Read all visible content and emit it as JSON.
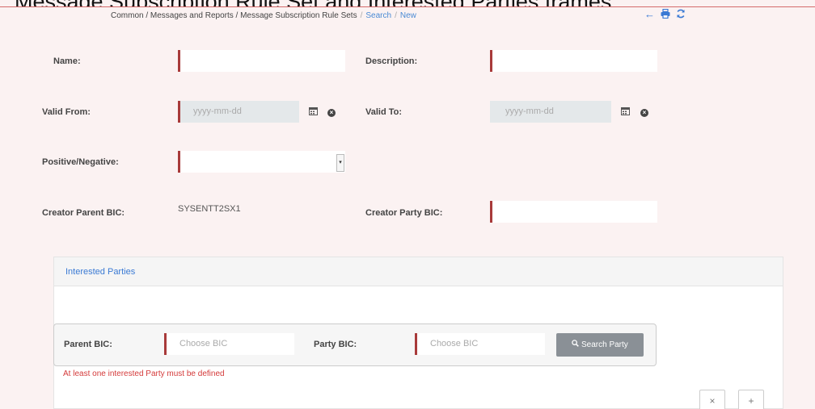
{
  "doc_title": "Message Subscription Rule Set and Interested Parties frames",
  "breadcrumb": {
    "path": "Common / Messages and Reports / Message Subscription Rule Sets",
    "search": "Search",
    "new": "New"
  },
  "form": {
    "name_label": "Name:",
    "description_label": "Description:",
    "valid_from_label": "Valid From:",
    "valid_from_placeholder": "yyyy-mm-dd",
    "valid_to_label": "Valid To:",
    "valid_to_placeholder": "yyyy-mm-dd",
    "positive_negative_label": "Positive/Negative:",
    "creator_parent_bic_label": "Creator Parent BIC:",
    "creator_parent_bic_value": "SYSENTT2SX1",
    "creator_party_bic_label": "Creator Party BIC:"
  },
  "interested_parties": {
    "title": "Interested Parties",
    "parent_bic_label": "Parent BIC:",
    "parent_bic_placeholder": "Choose BIC",
    "party_bic_label": "Party BIC:",
    "party_bic_placeholder": "Choose BIC",
    "search_button": "Search Party",
    "error": "At least one interested Party must be defined",
    "remove_symbol": "×",
    "add_symbol": "+"
  },
  "icons": {
    "back": "arrow-left-icon",
    "print": "print-icon",
    "refresh": "refresh-icon",
    "calendar": "calendar-icon",
    "clear": "clear-icon",
    "search": "search-icon"
  },
  "colors": {
    "accent": "#3a7ad4",
    "required_bar": "#a83a3a",
    "error": "#d43a3a",
    "background": "#fbf2f2"
  }
}
